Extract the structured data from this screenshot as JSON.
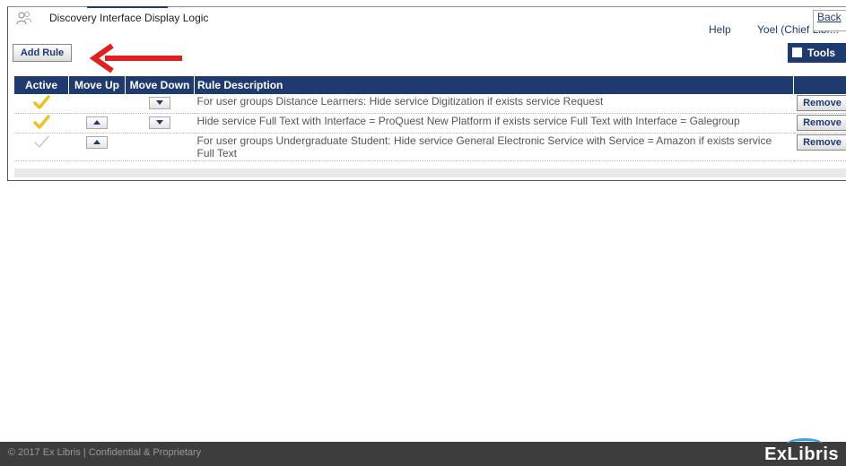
{
  "window": {
    "title": "Discovery Interface Display Logic",
    "help": "Help",
    "user": "Yoel (Chief Libr...",
    "back": "Back"
  },
  "toolbar": {
    "add_rule": "Add Rule",
    "tools": "Tools"
  },
  "table": {
    "headers": [
      "Active",
      "Move Up",
      "Move Down",
      "Rule Description",
      ""
    ],
    "rows": [
      {
        "active": true,
        "move_up": false,
        "move_down": true,
        "description": "For user groups Distance Learners: Hide service Digitization if exists service Request",
        "action": "Remove"
      },
      {
        "active": true,
        "move_up": true,
        "move_down": true,
        "description": "Hide service Full Text with Interface = ProQuest New Platform if exists service Full Text with Interface = Galegroup",
        "action": "Remove"
      },
      {
        "active": false,
        "move_up": true,
        "move_down": false,
        "description": "For user groups Undergraduate Student: Hide service General Electronic Service with Service = Amazon if exists service Full Text",
        "action": "Remove"
      }
    ]
  },
  "footer": {
    "copyright": "© 2017 Ex Libris | Confidential & Proprietary",
    "logo": "ExLibris"
  },
  "colors": {
    "header_bg": "#1f3a6e",
    "active_check": "#f0c020",
    "inactive_check": "#c8c8c8",
    "annotation_arrow": "#e31e1e",
    "footer_bg": "#3d3d3d"
  },
  "icons": {
    "title": "users-icon",
    "tools": "tools-icon",
    "active": "checkmark-icon",
    "move_up": "chevron-up-icon",
    "move_down": "chevron-down-icon"
  }
}
